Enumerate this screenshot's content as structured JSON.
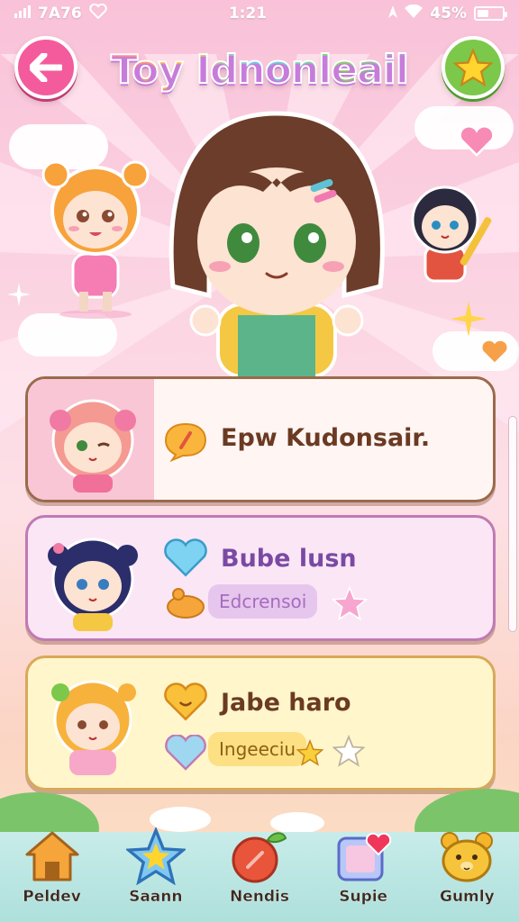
{
  "status_bar": {
    "left_text": "7A76",
    "time": "1:21",
    "battery": "45%",
    "battery_level": 0.45
  },
  "header": {
    "title": "Toy Idnonleail",
    "back_icon": "arrow-left-icon",
    "star_icon": "star-icon"
  },
  "cards": [
    {
      "title": "Epw Kudonsair.",
      "icon": "chat-bubble-icon"
    },
    {
      "title": "Bube lusn",
      "icon": "heart-icon",
      "pill": "Edcrensoi",
      "extra_icons": [
        "toy-icon",
        "star-icon"
      ]
    },
    {
      "title": "Jabe haro",
      "icon": "smiley-heart-icon",
      "pill": "Ingeeciu",
      "extra_icons": [
        "heart-icon",
        "star-icon",
        "star-icon"
      ]
    }
  ],
  "tabs": [
    {
      "label": "Peldev",
      "icon": "house-icon"
    },
    {
      "label": "Saann",
      "icon": "star-icon"
    },
    {
      "label": "Nendis",
      "icon": "carrot-icon"
    },
    {
      "label": "Supie",
      "icon": "heart-card-icon"
    },
    {
      "label": "Gumly",
      "icon": "bear-icon"
    }
  ],
  "colors": {
    "accent_pink": "#f45b9c",
    "accent_green": "#7cc84a",
    "card_border": "#9b6a4a",
    "tabbar": "#aee0dc"
  }
}
